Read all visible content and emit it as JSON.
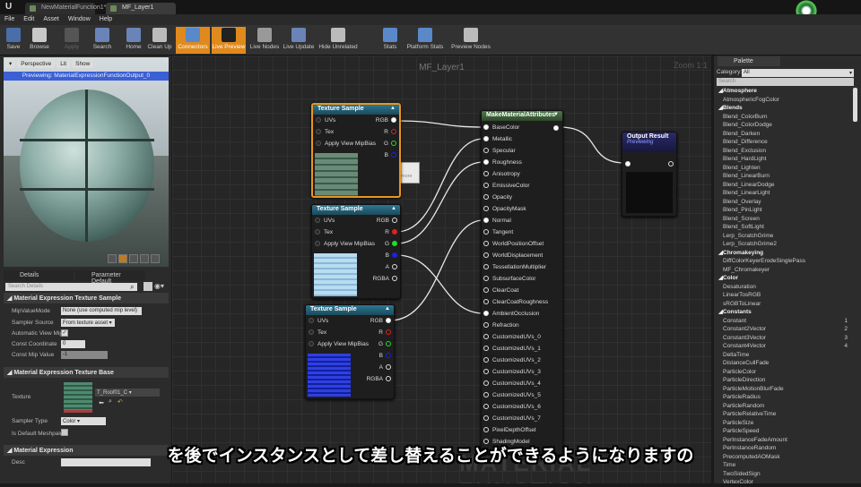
{
  "tabs": [
    {
      "label": "NewMaterialFunction1*"
    },
    {
      "label": "MF_Layer1"
    }
  ],
  "menu": [
    "File",
    "Edit",
    "Asset",
    "Window",
    "Help"
  ],
  "toolbar": [
    {
      "label": "Save",
      "icon": "save-icon",
      "state": "normal"
    },
    {
      "label": "Browse",
      "icon": "browse-icon",
      "state": "normal"
    },
    {
      "label": "Apply",
      "icon": "apply-icon",
      "state": "disabled"
    },
    {
      "label": "Search",
      "icon": "search-icon",
      "state": "normal"
    },
    {
      "label": "Home",
      "icon": "home-icon",
      "state": "normal"
    },
    {
      "label": "Clean Up",
      "icon": "clean-up-icon",
      "state": "normal"
    },
    {
      "label": "Connectors",
      "icon": "connectors-icon",
      "state": "active"
    },
    {
      "label": "Live Preview",
      "icon": "live-preview-icon",
      "state": "active"
    },
    {
      "label": "Live Nodes",
      "icon": "live-nodes-icon",
      "state": "normal"
    },
    {
      "label": "Live Update",
      "icon": "live-update-icon",
      "state": "normal"
    },
    {
      "label": "Hide Unrelated",
      "icon": "hide-unrelated-icon",
      "state": "normal"
    },
    {
      "label": "Stats",
      "icon": "stats-icon",
      "state": "normal"
    },
    {
      "label": "Platform Stats",
      "icon": "platform-stats-icon",
      "state": "normal"
    },
    {
      "label": "Preview Nodes",
      "icon": "preview-nodes-icon",
      "state": "normal"
    }
  ],
  "viewport": {
    "perspective": "Perspective",
    "lit": "Lit",
    "show": "Show",
    "previewing": "Previewing: MaterialExpressionFunctionOutput_0"
  },
  "details": {
    "tabs": [
      "Details",
      "Parameter Default"
    ],
    "search_placeholder": "Search Details",
    "sections": [
      {
        "title": "Material Expression Texture Sample",
        "props": [
          {
            "label": "MipValueMode",
            "value": "None (use computed mip level)"
          },
          {
            "label": "Sampler Source",
            "value": "From texture asset"
          },
          {
            "label": "Automatic View Mip I",
            "value": "checked"
          },
          {
            "label": "Const Coordinate",
            "value": "0"
          },
          {
            "label": "Const Mip Value",
            "value": "-1"
          }
        ]
      },
      {
        "title": "Material Expression Texture Base",
        "props": [
          {
            "label": "Texture",
            "value": "T_Roof01_C"
          },
          {
            "label": "Sampler Type",
            "value": "Color"
          },
          {
            "label": "Is Default Meshpaint",
            "value": "unchecked"
          }
        ]
      },
      {
        "title": "Material Expression",
        "props": [
          {
            "label": "Desc",
            "value": ""
          }
        ]
      }
    ]
  },
  "graph": {
    "title": "MF_Layer1",
    "zoom": "Zoom 1:1",
    "watermark": "MATERIAL FUNCTION",
    "tooltip": {
      "title": "Texture Sample",
      "hint": "hold (Ctrl + Alt) for more"
    },
    "texture_nodes": [
      {
        "title": "Texture Sample",
        "inputs": [
          "UVs",
          "Tex",
          "Apply View MipBias"
        ],
        "outputs": [
          "RGB",
          "R",
          "G",
          "B"
        ]
      },
      {
        "title": "Texture Sample",
        "inputs": [
          "UVs",
          "Tex",
          "Apply View MipBias"
        ],
        "outputs": [
          "RGB",
          "R",
          "G",
          "B",
          "A",
          "RGBA"
        ]
      },
      {
        "title": "Texture Sample",
        "inputs": [
          "UVs",
          "Tex",
          "Apply View MipBias"
        ],
        "outputs": [
          "RGB",
          "R",
          "G",
          "B",
          "A",
          "RGBA"
        ]
      }
    ],
    "make_attributes": {
      "title": "MakeMaterialAttributes",
      "pins": [
        "BaseColor",
        "Metallic",
        "Specular",
        "Roughness",
        "Anisotropy",
        "EmissiveColor",
        "Opacity",
        "OpacityMask",
        "Normal",
        "Tangent",
        "WorldPositionOffset",
        "WorldDisplacement",
        "TessellationMultiplier",
        "SubsurfaceColor",
        "ClearCoat",
        "ClearCoatRoughness",
        "AmbientOcclusion",
        "Refraction",
        "CustomizedUVs_0",
        "CustomizedUVs_1",
        "CustomizedUVs_2",
        "CustomizedUVs_3",
        "CustomizedUVs_4",
        "CustomizedUVs_5",
        "CustomizedUVs_6",
        "CustomizedUVs_7",
        "PixelDepthOffset",
        "ShadingModel"
      ],
      "connected": [
        "BaseColor",
        "Metallic",
        "Roughness",
        "Normal",
        "AmbientOcclusion"
      ]
    },
    "output": {
      "title": "Output Result",
      "subtitle": "Previewing"
    }
  },
  "palette": {
    "tab": "Palette",
    "category_label": "Category:",
    "category": "All",
    "search_placeholder": "Search",
    "items": [
      {
        "t": "Atmosphere",
        "cat": true
      },
      {
        "t": "AtmosphericFogColor"
      },
      {
        "t": "Blends",
        "cat": true
      },
      {
        "t": "Blend_ColorBurn"
      },
      {
        "t": "Blend_ColorDodge"
      },
      {
        "t": "Blend_Darken"
      },
      {
        "t": "Blend_Difference"
      },
      {
        "t": "Blend_Exclusion"
      },
      {
        "t": "Blend_HardLight"
      },
      {
        "t": "Blend_Lighten"
      },
      {
        "t": "Blend_LinearBurn"
      },
      {
        "t": "Blend_LinearDodge"
      },
      {
        "t": "Blend_LinearLight"
      },
      {
        "t": "Blend_Overlay"
      },
      {
        "t": "Blend_PinLight"
      },
      {
        "t": "Blend_Screen"
      },
      {
        "t": "Blend_SoftLight"
      },
      {
        "t": "Lerp_ScratchGrime"
      },
      {
        "t": "Lerp_ScratchGrime2"
      },
      {
        "t": "Chromakeying",
        "cat": true
      },
      {
        "t": "DiffColorKeyerErodeSinglePass"
      },
      {
        "t": "MF_Chromakeyer"
      },
      {
        "t": "Color",
        "cat": true
      },
      {
        "t": "Desaturation"
      },
      {
        "t": "LinearTosRGB"
      },
      {
        "t": "sRGBToLinear"
      },
      {
        "t": "Constants",
        "cat": true
      },
      {
        "t": "Constant",
        "n": "1"
      },
      {
        "t": "Constant2Vector",
        "n": "2"
      },
      {
        "t": "Constant3Vector",
        "n": "3"
      },
      {
        "t": "Constant4Vector",
        "n": "4"
      },
      {
        "t": "DeltaTime"
      },
      {
        "t": "DistanceCullFade"
      },
      {
        "t": "ParticleColor"
      },
      {
        "t": "ParticleDirection"
      },
      {
        "t": "ParticleMotionBlurFade"
      },
      {
        "t": "ParticleRadius"
      },
      {
        "t": "ParticleRandom"
      },
      {
        "t": "ParticleRelativeTime"
      },
      {
        "t": "ParticleSize"
      },
      {
        "t": "ParticleSpeed"
      },
      {
        "t": "PerInstanceFadeAmount"
      },
      {
        "t": "PerInstanceRandom"
      },
      {
        "t": "PrecomputedAOMask"
      },
      {
        "t": "Time"
      },
      {
        "t": "TwoSidedSign"
      },
      {
        "t": "VertexColor"
      }
    ]
  },
  "subtitle": "を後でインスタンスとして差し替えることができるようになりますの",
  "colors": {
    "accent": "#e08a1e",
    "node_header": "#2d7793",
    "previewing": "#3b5fd4",
    "pin_r": "#e02020",
    "pin_g": "#20e020",
    "pin_b": "#2020e0"
  }
}
